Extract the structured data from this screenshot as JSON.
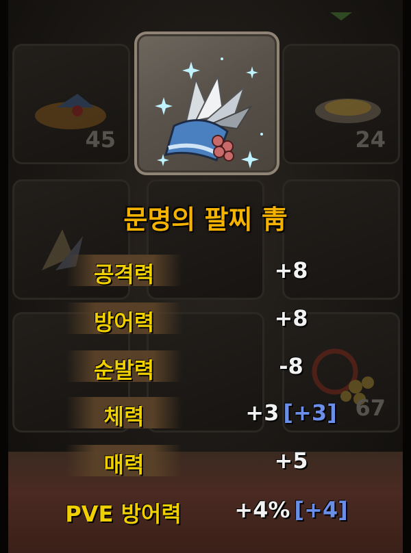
{
  "item": {
    "name": "문명의 팔찌 靑"
  },
  "inventory": {
    "slots": [
      {
        "id": "slot-1",
        "count": "45",
        "icon": "bread-icon"
      },
      {
        "id": "slot-2",
        "count": "",
        "icon": "bracelet-icon",
        "selected": true
      },
      {
        "id": "slot-3",
        "count": "24",
        "icon": "dish-icon"
      },
      {
        "id": "slot-4",
        "count": "",
        "icon": "feather-icon"
      },
      {
        "id": "slot-5",
        "count": "",
        "icon": "empty"
      },
      {
        "id": "slot-6",
        "count": "",
        "icon": "empty"
      },
      {
        "id": "slot-7",
        "count": "",
        "icon": "empty"
      },
      {
        "id": "slot-8",
        "count": "",
        "icon": "empty"
      },
      {
        "id": "slot-9",
        "count": "67",
        "icon": "necklace-icon"
      }
    ]
  },
  "stats": [
    {
      "label": "공격력",
      "value": "+8",
      "bonus": ""
    },
    {
      "label": "방어력",
      "value": "+8",
      "bonus": ""
    },
    {
      "label": "순발력",
      "value": "-8",
      "bonus": ""
    },
    {
      "label": "체력",
      "value": "+3",
      "bonus": "[+3]"
    },
    {
      "label": "매력",
      "value": "+5",
      "bonus": ""
    },
    {
      "label": "PVE 방어력",
      "value": "+4%",
      "bonus": "[+4]"
    }
  ],
  "colors": {
    "title": "#f5b300",
    "label": "#f0d000",
    "value": "#f2f2f2",
    "bonus": "#6b8fe8"
  }
}
